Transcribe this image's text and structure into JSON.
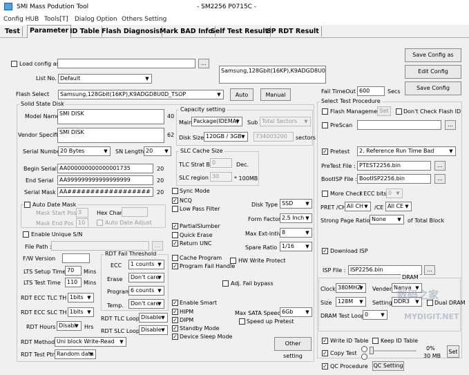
{
  "window": {
    "app_title": "SMI Mass Podution Tool",
    "center_title": "- SM2256 P0715C -"
  },
  "menu": [
    "Config HUB",
    "Tools[T]",
    "Dialog Option",
    "Others Setting"
  ],
  "tabs": [
    "Test",
    "Parameter",
    "ID Table",
    "Flash Diagnosis",
    "Mark BAD Info",
    "Self Test Result",
    "8P RDT Result"
  ],
  "top": {
    "load_config_label": "Load config as",
    "browse_label": "...",
    "flash_info_text": "Samsung,128Gbit(16KP),K9ADGD8U0D_TSOP",
    "list_no_label": "List No.",
    "list_no_value": "Default",
    "flash_select_label": "Flash Select",
    "flash_select_value": "Samsung,128Gbit(16KP),K9ADGD8U0D_TSOP",
    "auto_label": "Auto",
    "manual_label": "Manual",
    "save_config_as": "Save Config as",
    "edit_config": "Edit Config",
    "save_config": "Save Config",
    "fail_timeout_label": "Fail TimeOut",
    "fail_timeout_value": "600",
    "secs": "Secs"
  },
  "solid_state_disk": {
    "title": "Solid State Disk",
    "model_name_label": "Model Name",
    "model_name_value": "SMI DISK",
    "model_name_len": "40",
    "vendor_specific_label": "Vendor Specific",
    "vendor_specific_value": "SMI DISK",
    "vendor_specific_len": "62",
    "serial_number_label": "Serial Number",
    "serial_number_value": "20 Bytes",
    "sn_length_label": "SN Length",
    "sn_length_value": "20",
    "begin_serial_label": "Begin Serial",
    "begin_serial_value": "AA000000000000001735",
    "begin_serial_len": "20",
    "end_serial_label": "End Serial",
    "end_serial_value": "AA999999999999999999",
    "end_serial_len": "20",
    "serial_mask_label": "Serial Mask",
    "serial_mask_value": "AA##################",
    "serial_mask_len": "20",
    "auto_date_mask_label": "Auto Date Mask",
    "mask_start_pos_label": "Mask Start Pos",
    "mask_start_pos_value": "3",
    "hex_char_label": "Hex Char:",
    "mask_end_pos_label": "Mask End Pos",
    "mask_end_pos_value": "10",
    "auto_date_adjust_label": "Auto Date Adjust",
    "enable_unique_sn_label": "Enable Unique S/N",
    "file_path_label": "File Path :",
    "fw_version_label": "F/W Version",
    "lts_setup_time_label": "LTS Setup Time",
    "lts_setup_time_value": "70",
    "lts_test_time_label": "LTS Test Time",
    "lts_test_time_value": "110",
    "mins": "Mins",
    "rdt_ecc_tlc_label": "RDT ECC TLC TH",
    "rdt_ecc_tlc_value": "1bits",
    "rdt_ecc_slc_label": "RDT ECC SLC TH",
    "rdt_ecc_slc_value": "1bits",
    "rdt_hours_label": "RDT Hours",
    "rdt_hours_value": "Disabl",
    "hrs": "Hrs",
    "rdt_method_label": "RDT Method",
    "rdt_method_value": "Uni block Write-Read",
    "rdt_test_ptn_label": "RDT Test Ptn.",
    "rdt_test_ptn_value": "Random data"
  },
  "rdt_fail_threshold": {
    "title": "RDT Fail Threshold",
    "ecc_label": "ECC",
    "ecc_value": "1 counts",
    "erase_label": "Erase",
    "erase_value": "Don't care",
    "program_label": "Program",
    "program_value": "6 counts",
    "temp_label": "Temp.",
    "temp_value": "Don't care",
    "rdt_tlc_loops_label": "RDT TLC Loops",
    "rdt_tlc_loops_value": "Disable",
    "rdt_slc_loops_label": "RDT SLC Loops",
    "rdt_slc_loops_value": "Disable"
  },
  "capacity": {
    "title": "Capacity setting",
    "main_label": "Main",
    "main_value": "Package(IDEMA)",
    "sub_label": "Sub",
    "sub_value": "Total Sectors",
    "disk_size_label": "Disk Size",
    "disk_size_value": "120GB / 3GB",
    "sectors_value": "734003200",
    "sectors_label": "sectors"
  },
  "slc_cache": {
    "title": "SLC Cache Size",
    "tlc_strat_label": "TLC Strat Bk",
    "tlc_strat_value": "0",
    "dec_label": "Dec.",
    "slc_region_label": "SLC region",
    "slc_region_value": "30",
    "unit_label": "* 100MB"
  },
  "options": {
    "sync_mode": "Sync Mode",
    "ncq": "NCQ",
    "low_pass_filter": "Low Pass Filter",
    "partial_slumber": "PartialSlumber",
    "quick_erase": "Quick Erase",
    "return_unc": "Return UNC",
    "cache_program": "Cache Program",
    "program_fail_handle": "Program Fail Handle",
    "hw_write_protect": "HW Write Protect",
    "adj_fail_bypass": "Adj. Fail bypass",
    "enable_smart": "Enable Smart",
    "hipm": "HIPM",
    "dipm": "DIPM",
    "standby_mode": "Standby Mode",
    "device_sleep_mode": "Device Sleep Mode",
    "disk_type_label": "Disk Type",
    "disk_type_value": "SSD",
    "form_factor_label": "Form Factor",
    "form_factor_value": "2.5 Inch",
    "max_ext_intv_label": "Max Ext-Intiv",
    "max_ext_intv_value": "8",
    "spare_ratio_label": "Spare Ratio",
    "spare_ratio_value": "1/16",
    "max_sata_speed_label": "Max SATA Speed",
    "max_sata_speed_value": "6Gb",
    "speed_up_pretest": "Speed up Pretest",
    "other_setting": "Other setting"
  },
  "select_test": {
    "title": "Select Test Procedure",
    "flash_management": "Flash Management",
    "set_label": "Set",
    "dont_check_flash_id": "Don't Check Flash ID",
    "prescan": "PreScan",
    "pretest": "Pretest",
    "pretest_value": "2. Reference Run Time Bad",
    "pretest_file_label": "PreTest File :",
    "pretest_file_value": "PTEST2256.bin",
    "bootisp_file_label": "BootISP File :",
    "bootisp_file_value": "BootISP2256.bin",
    "more_check_label": "More Check",
    "ecc_bits_label": "/ ECC bits",
    "ecc_bits_value": "0",
    "pret_ch_label": "PRET /CH",
    "pret_ch_value": "All CH",
    "ce_label": "/CE",
    "ce_value": "All CE",
    "strong_page_label": "Strong Page Ratio :",
    "strong_page_value": "None",
    "of_total_block": "of Total Block",
    "download_isp": "Download ISP",
    "isp_file_label": "ISP File :",
    "isp_file_value": "ISP2256.bin"
  },
  "dram": {
    "title": "DRAM",
    "clock_label": "Clock",
    "clock_value": "380MHZ",
    "vender_label": "Vender",
    "vender_value": "Nanya",
    "size_label": "Size",
    "size_value": "128M",
    "setting_label": "Setting",
    "setting_value": "DDR3",
    "dual_dram": "Dual DRAM",
    "dram_test_loop_label": "DRAM Test Loop",
    "dram_test_loop_value": "0"
  },
  "bottom_right": {
    "write_id_table": "Write ID Table",
    "keep_id_table": "Keep ID Table",
    "copy_test": "Copy Test",
    "copy_percent": "0%",
    "copy_size": "30 MB",
    "set_label": "Set",
    "qc_procedure": "QC Procedure",
    "qc_setting": "QC Setting"
  },
  "colors": {
    "accent": "#1d5fb0",
    "disabled_text": "#9a9a9a"
  }
}
